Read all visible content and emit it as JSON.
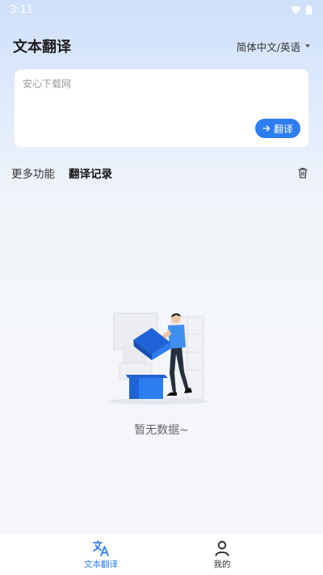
{
  "status_bar": {
    "time": "3:11"
  },
  "header": {
    "title": "文本翻译",
    "language_pair": "简体中文/英语"
  },
  "input": {
    "value": "安心下载网",
    "translate_label": "翻译"
  },
  "tabs": [
    {
      "label": "更多功能",
      "active": false
    },
    {
      "label": "翻译记录",
      "active": true
    }
  ],
  "empty_state": {
    "message": "暂无数据~"
  },
  "bottom_nav": [
    {
      "label": "文本翻译",
      "icon": "translate-icon",
      "active": true
    },
    {
      "label": "我的",
      "icon": "person-icon",
      "active": false
    }
  ],
  "colors": {
    "accent": "#2c7df0",
    "background_top": "#cfe0fb",
    "background_bottom": "#f6f7fb"
  }
}
